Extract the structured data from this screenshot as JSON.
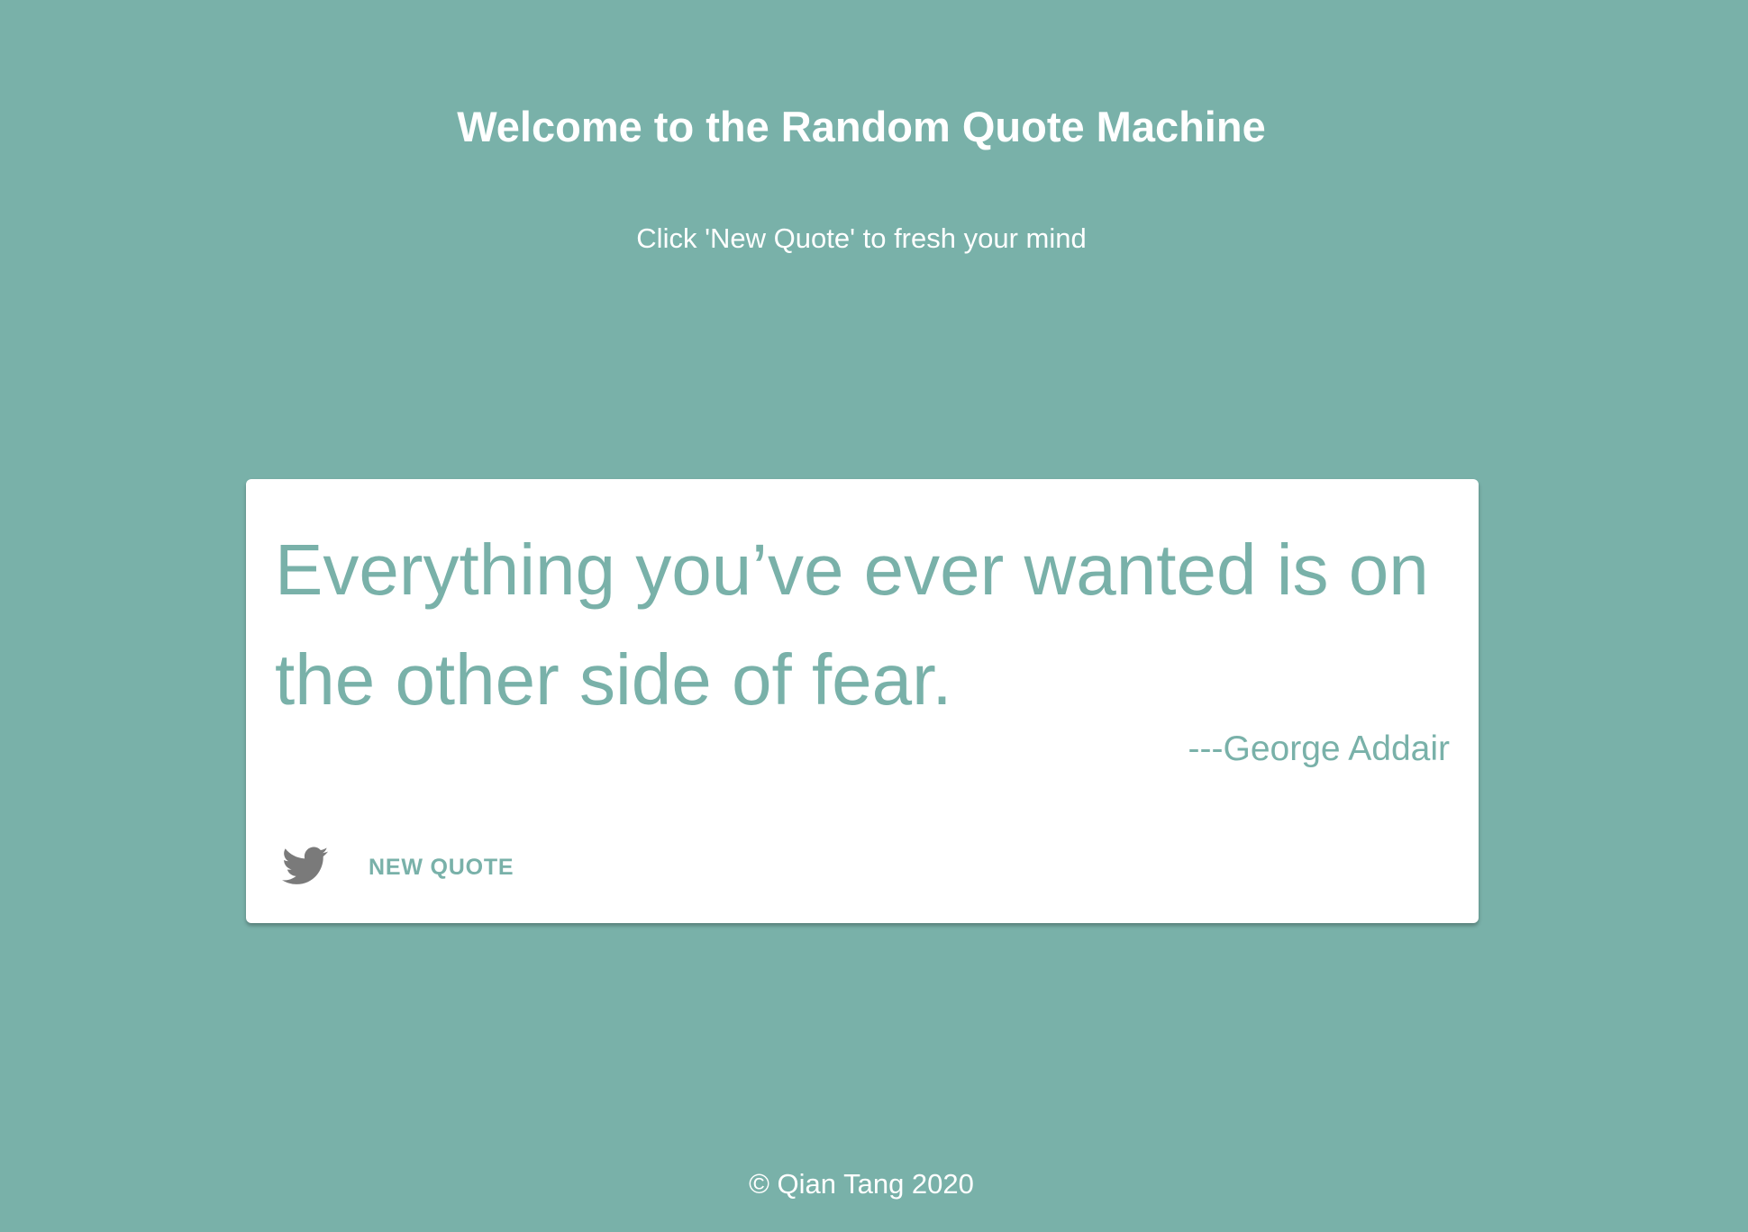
{
  "header": {
    "title": "Welcome to the Random Quote Machine",
    "subtitle": "Click 'New Quote' to fresh your mind"
  },
  "quote": {
    "text": "Everything you’ve ever wanted is on the other side of fear.",
    "author": "---George Addair"
  },
  "actions": {
    "tweet_icon": "twitter-icon",
    "new_quote_label": "NEW QUOTE"
  },
  "footer": {
    "copyright": "© Qian Tang 2020"
  },
  "colors": {
    "background": "#79b1a9",
    "card": "#ffffff",
    "accent": "#79b1a9",
    "icon": "#7a7a7a",
    "header_text": "#ffffff"
  }
}
